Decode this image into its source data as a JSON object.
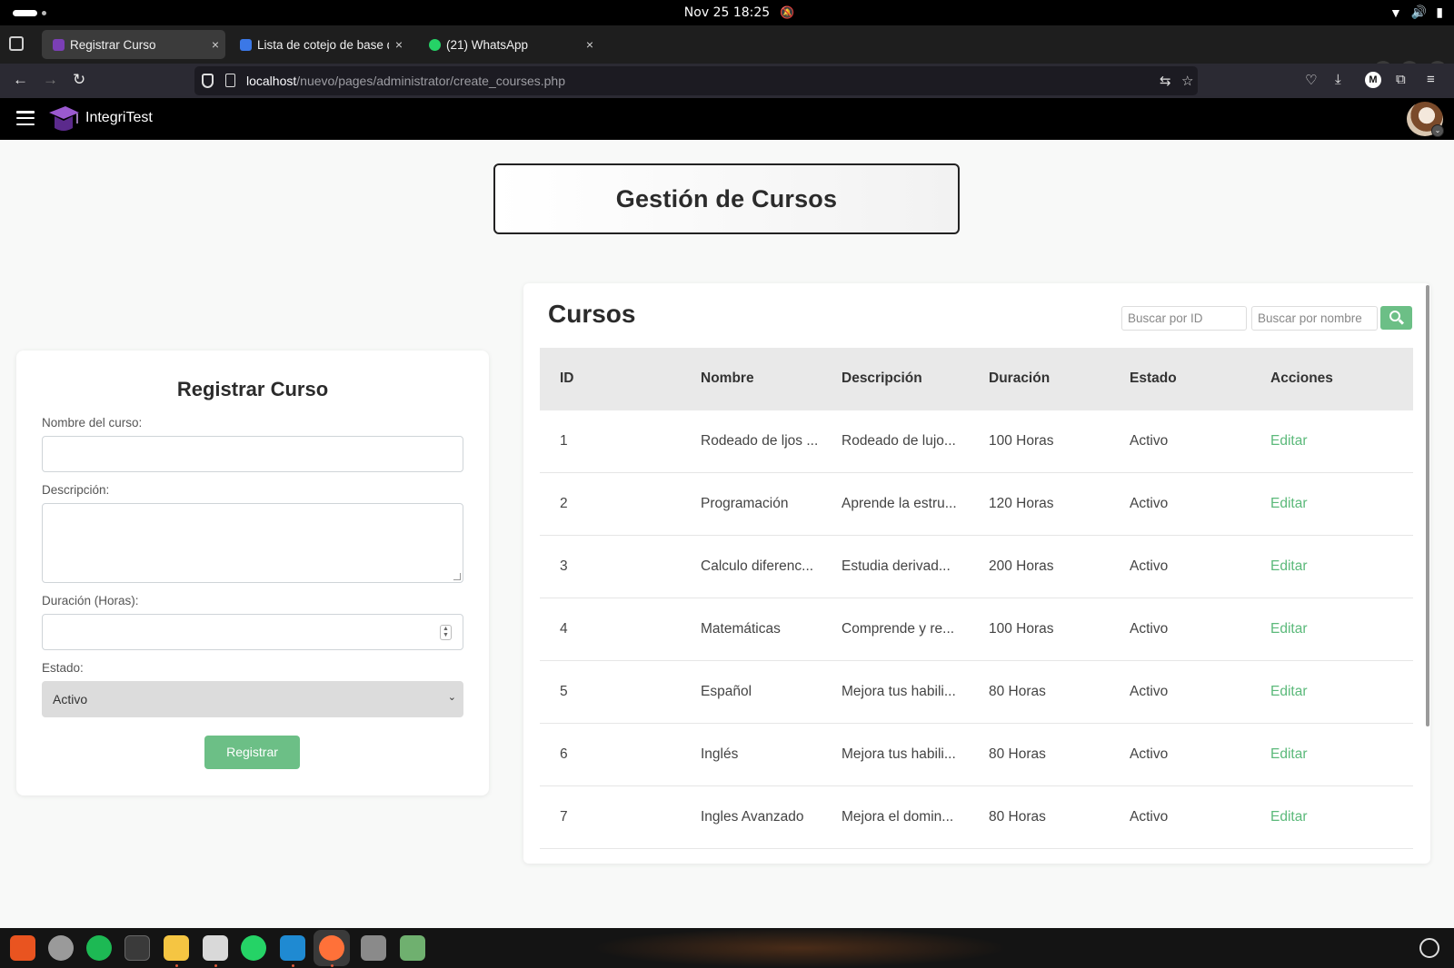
{
  "system": {
    "clock": "Nov 25  18:25"
  },
  "browser": {
    "tabs": [
      {
        "title": "Registrar Curso",
        "active": true,
        "favicon_color": "#7b3fb5"
      },
      {
        "title": "Lista de cotejo de base d",
        "active": false,
        "favicon_color": "#3b78e7"
      },
      {
        "title": "(21) WhatsApp",
        "active": false,
        "favicon_color": "#25d366"
      }
    ],
    "close_glyph": "×",
    "new_tab_glyph": "+",
    "url_host": "localhost",
    "url_path": "/nuevo/pages/administrator/create_courses.php",
    "profile_initial": "M"
  },
  "app": {
    "brand": "IntegriTest",
    "page_title": "Gestión de Cursos"
  },
  "form": {
    "title": "Registrar Curso",
    "name_label": "Nombre del curso:",
    "name_value": "",
    "description_label": "Descripción:",
    "description_value": "",
    "duration_label": "Duración (Horas):",
    "duration_value": "",
    "status_label": "Estado:",
    "status_selected": "Activo",
    "submit_label": "Registrar"
  },
  "courses": {
    "title": "Cursos",
    "search_id_placeholder": "Buscar por ID",
    "search_name_placeholder": "Buscar por nombre",
    "headers": [
      "ID",
      "Nombre",
      "Descripción",
      "Duración",
      "Estado",
      "Acciones"
    ],
    "rows": [
      {
        "id": "1",
        "name": "Rodeado de ljos ...",
        "description": "Rodeado de lujo...",
        "duration": "100 Horas",
        "status": "Activo",
        "action": "Editar"
      },
      {
        "id": "2",
        "name": "Programación",
        "description": "Aprende la estru...",
        "duration": "120 Horas",
        "status": "Activo",
        "action": "Editar"
      },
      {
        "id": "3",
        "name": "Calculo diferenc...",
        "description": "Estudia derivad...",
        "duration": "200 Horas",
        "status": "Activo",
        "action": "Editar"
      },
      {
        "id": "4",
        "name": "Matemáticas",
        "description": "Comprende y re...",
        "duration": "100 Horas",
        "status": "Activo",
        "action": "Editar"
      },
      {
        "id": "5",
        "name": "Español",
        "description": "Mejora tus habili...",
        "duration": "80 Horas",
        "status": "Activo",
        "action": "Editar"
      },
      {
        "id": "6",
        "name": "Inglés",
        "description": "Mejora tus habili...",
        "duration": "80 Horas",
        "status": "Activo",
        "action": "Editar"
      },
      {
        "id": "7",
        "name": "Ingles Avanzado",
        "description": "Mejora el domin...",
        "duration": "80 Horas",
        "status": "Activo",
        "action": "Editar"
      }
    ]
  },
  "colors": {
    "accent_green": "#6cbf86",
    "edit_link": "#5bb97a",
    "header_bg": "#000000"
  },
  "dock": {
    "apps": [
      {
        "name": "app-center-icon",
        "color": "#e95420"
      },
      {
        "name": "settings-icon",
        "color": "#9a9a9a"
      },
      {
        "name": "spotify-icon",
        "color": "#1db954"
      },
      {
        "name": "terminal-icon",
        "color": "#3a3a3a"
      },
      {
        "name": "text-editor-icon",
        "color": "#f5c542"
      },
      {
        "name": "files-icon",
        "color": "#d9d9d9"
      },
      {
        "name": "whatsapp-icon",
        "color": "#25d366"
      },
      {
        "name": "vscode-icon",
        "color": "#1f8ad2"
      },
      {
        "name": "firefox-icon",
        "color": "#ff7139"
      },
      {
        "name": "ssd-icon",
        "color": "#8a8a8a"
      },
      {
        "name": "trash-icon",
        "color": "#6fb06f"
      }
    ]
  }
}
